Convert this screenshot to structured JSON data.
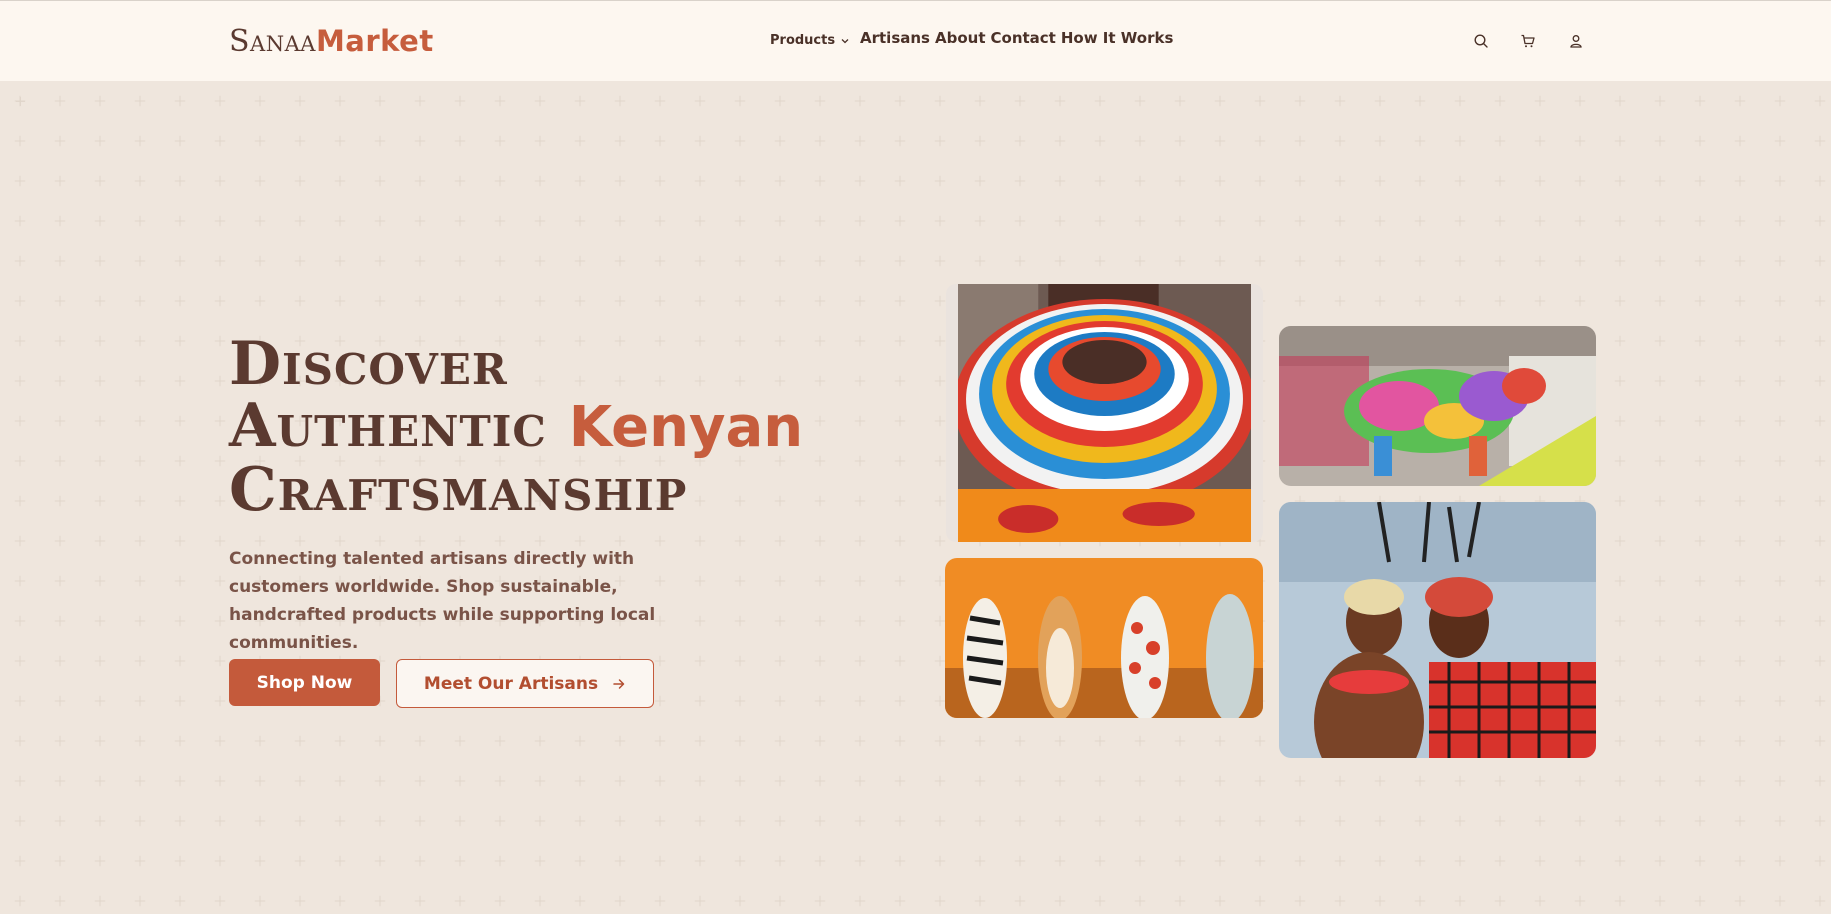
{
  "header": {
    "logo_part1": "Sanaa",
    "logo_part2": "Market",
    "nav": {
      "products_label": "Products",
      "links": [
        "Artisans",
        "About",
        "Contact",
        "How It Works"
      ]
    },
    "icons": [
      "search-icon",
      "cart-icon",
      "user-icon"
    ]
  },
  "hero": {
    "headline_line1": "Discover",
    "headline_line2": "Authentic",
    "headline_accent": "Kenyan",
    "headline_line3": "Craftsmanship",
    "subtext": "Connecting talented artisans directly with customers worldwide. Shop sustainable, handcrafted products while supporting local communities.",
    "primary_button": "Shop Now",
    "secondary_button": "Meet Our Artisans"
  },
  "colors": {
    "brand_dark": "#5b3a30",
    "brand_accent": "#c65d3d",
    "header_bg": "#fdf7f0",
    "hero_bg": "#efe6dd"
  },
  "images": [
    {
      "name": "beaded-necklace-photo"
    },
    {
      "name": "recycled-flipflop-hippo-photo"
    },
    {
      "name": "carved-animal-figurines-photo"
    },
    {
      "name": "maasai-warriors-photo"
    }
  ]
}
